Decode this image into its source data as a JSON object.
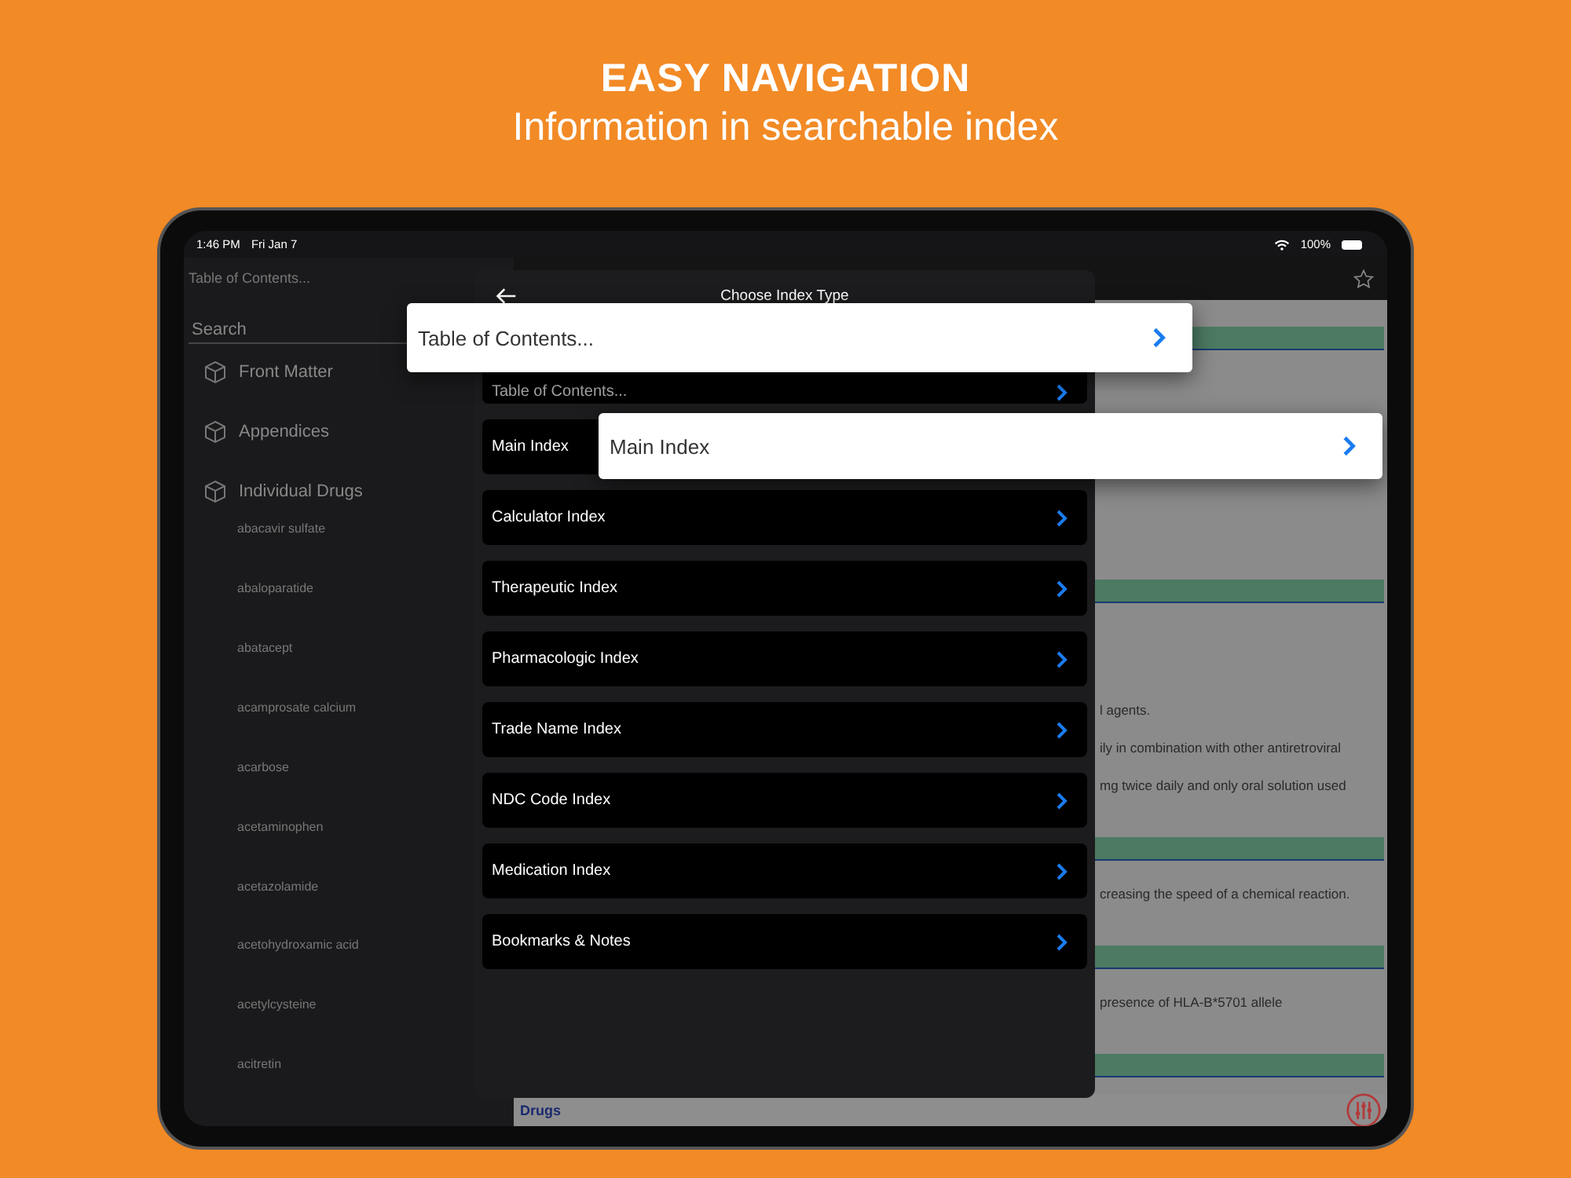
{
  "headline": {
    "title": "EASY NAVIGATION",
    "subtitle": "Information in searchable index"
  },
  "status_bar": {
    "time": "1:46 PM",
    "date": "Fri Jan 7",
    "battery": "100%"
  },
  "sidebar": {
    "title": "Table of Contents...",
    "search": {
      "placeholder": "Search"
    },
    "sections": [
      {
        "label": "Front Matter"
      },
      {
        "label": "Appendices"
      },
      {
        "label": "Individual Drugs"
      }
    ],
    "drugs": [
      "abacavir sulfate",
      "abaloparatide",
      "abatacept",
      "acamprosate calcium",
      "acarbose",
      "acetaminophen",
      "acetazolamide",
      "acetohydroxamic acid",
      "acetylcysteine",
      "acitretin"
    ]
  },
  "content": {
    "blocks": [
      {
        "kind": "bar"
      },
      {
        "kind": "space"
      },
      {
        "kind": "bar"
      },
      {
        "kind": "text",
        "text": "l agents."
      },
      {
        "kind": "text",
        "text": "ily in combination with other antiretroviral"
      },
      {
        "kind": "text",
        "text": "mg twice daily and only oral solution used"
      },
      {
        "kind": "bar"
      },
      {
        "kind": "text",
        "text": "creasing the speed of a chemical reaction."
      },
      {
        "kind": "bar"
      },
      {
        "kind": "text",
        "text": "presence of HLA-B*5701 allele"
      },
      {
        "kind": "bar"
      }
    ],
    "footer": "Drugs"
  },
  "dialog": {
    "title": "Choose Index Type",
    "items": [
      {
        "label": "Table of Contents...",
        "chevron": true
      },
      {
        "label": "Main Index",
        "chevron": false
      },
      {
        "label": "Calculator Index",
        "chevron": true
      },
      {
        "label": "Therapeutic Index",
        "chevron": true
      },
      {
        "label": "Pharmacologic Index",
        "chevron": true
      },
      {
        "label": "Trade Name Index",
        "chevron": true
      },
      {
        "label": "NDC Code Index",
        "chevron": true
      },
      {
        "label": "Medication Index",
        "chevron": true
      },
      {
        "label": "Bookmarks & Notes",
        "chevron": true
      }
    ]
  },
  "callouts": [
    {
      "label": "Table of Contents..."
    },
    {
      "label": "Main Index"
    }
  ]
}
